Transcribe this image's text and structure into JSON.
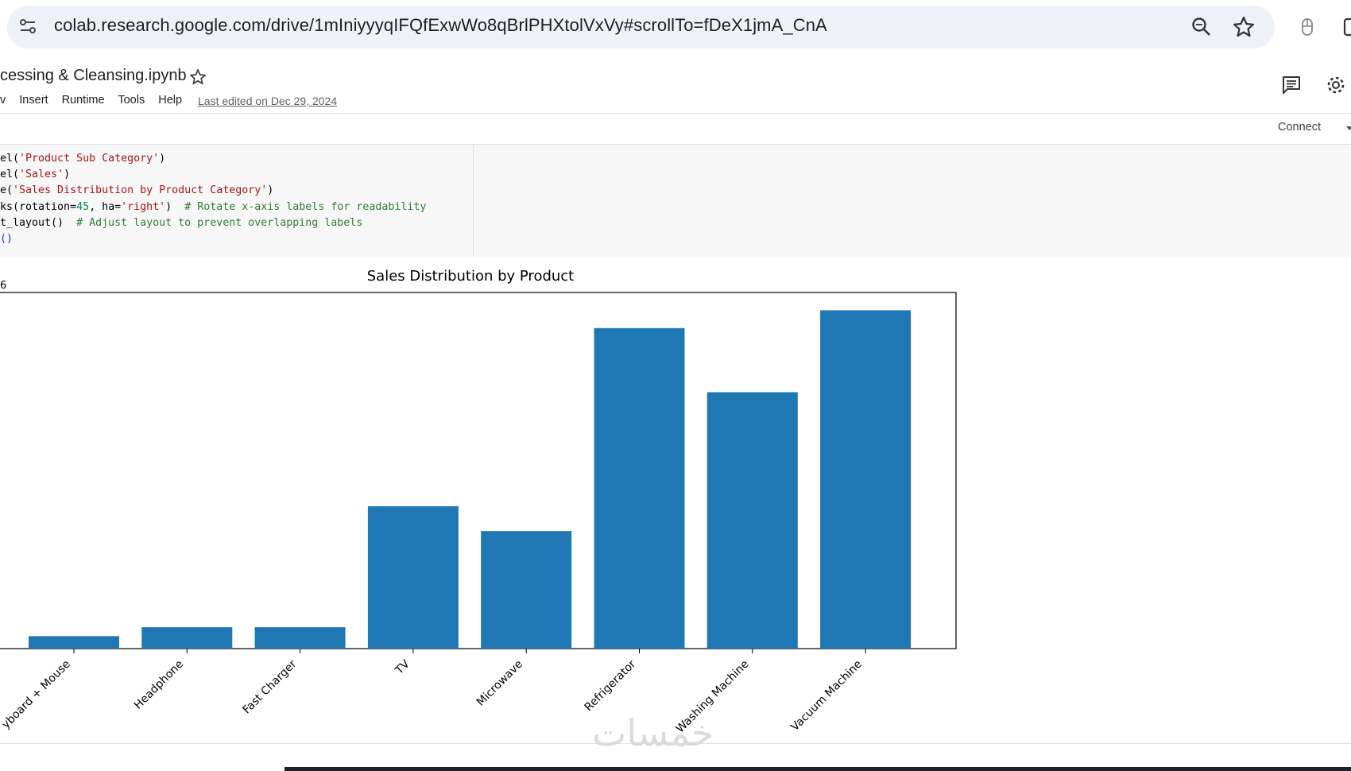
{
  "browser": {
    "url": "colab.research.google.com/drive/1mIniyyyqIFQfExwWo8qBrlPHXtolVxVy#scrollTo=fDeX1jmA_CnA",
    "icons": [
      "site-info-icon",
      "zoom-icon",
      "bookmark-star-icon",
      "extension-icon"
    ]
  },
  "notebook": {
    "title": "cessing & Cleansing.ipynb",
    "menu": [
      "v",
      "Insert",
      "Runtime",
      "Tools",
      "Help"
    ],
    "last_edited": "Last edited on Dec 29, 2024",
    "connect_label": "Connect"
  },
  "code_lines": [
    "el('Product Sub Category')",
    "el('Sales')",
    "e('Sales Distribution by Product Category')",
    "ks(rotation=45, ha='right')  # Rotate x-axis labels for readability",
    "t_layout()  # Adjust layout to prevent overlapping labels",
    "()"
  ],
  "colors": {
    "bar": "#1f77b4",
    "code_bg": "#f7f7f7",
    "omnibox_bg": "#eef2f8"
  },
  "chart_data": {
    "type": "bar",
    "title": "Sales Distribution by Product",
    "offset_label": "6",
    "categories": [
      "yboard + Mouse",
      "Headphone",
      "Fast Charger",
      "TV",
      "Microwave",
      "Refrigerator",
      "Washing Machine",
      "Vacuum Machine"
    ],
    "values": [
      0.035,
      0.06,
      0.06,
      0.4,
      0.33,
      0.9,
      0.72,
      0.95
    ],
    "ylim": [
      0,
      1
    ],
    "grid": false
  },
  "watermark": "خمسات"
}
